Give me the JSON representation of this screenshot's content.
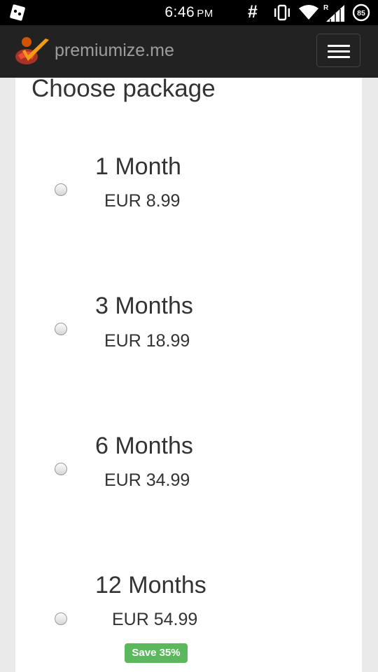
{
  "status_bar": {
    "time": "6:46",
    "ampm": "PM",
    "hash": "#",
    "battery_level": "85",
    "icons": [
      "notification-app-icon",
      "vibrate-icon",
      "wifi-icon",
      "signal-roaming-icon",
      "battery-icon"
    ]
  },
  "navbar": {
    "brand": "premiumize.me",
    "menu_icon": "hamburger-menu-icon"
  },
  "page": {
    "heading": "Choose package",
    "packages": [
      {
        "name": "1 Month",
        "price": "EUR 8.99"
      },
      {
        "name": "3 Months",
        "price": "EUR 18.99"
      },
      {
        "name": "6 Months",
        "price": "EUR 34.99"
      },
      {
        "name": "12 Months",
        "price": "EUR 54.99",
        "badge": "Save 35%"
      }
    ]
  },
  "colors": {
    "navbar_bg": "#222222",
    "brand_text": "#9d9d9d",
    "badge_bg": "#5cb85c",
    "page_bg": "#eaeaea",
    "logo_orange": "#f39c12",
    "logo_red": "#c0392b"
  }
}
